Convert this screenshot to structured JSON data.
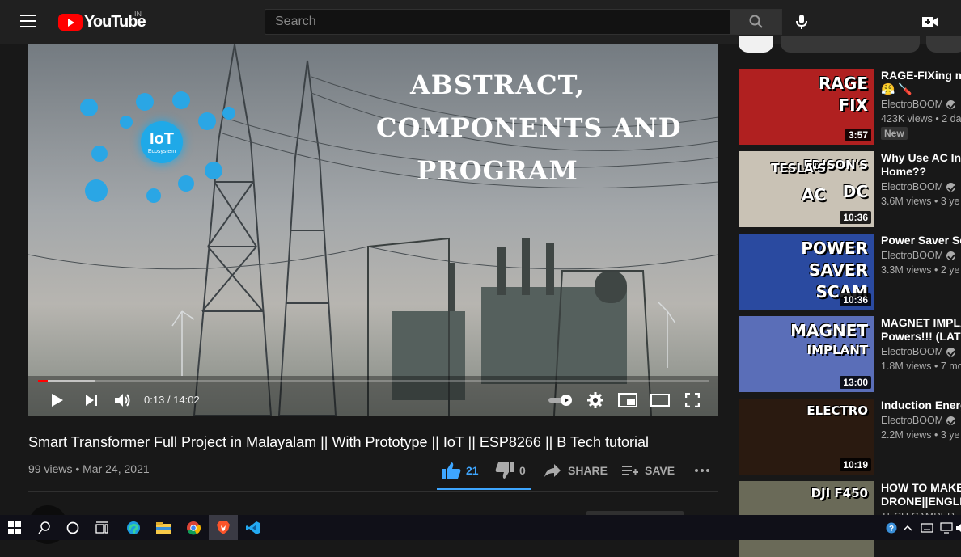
{
  "header": {
    "logo_text": "YouTube",
    "region": "IN",
    "search_placeholder": "Search",
    "icons": [
      "menu-icon",
      "search-icon",
      "mic-icon",
      "create-video-icon"
    ]
  },
  "player": {
    "overlay_lines": [
      "ABSTRACT,",
      "COMPONENTS AND",
      "PROGRAM"
    ],
    "iot_label": "IoT",
    "iot_sub": "Ecosystem",
    "time": "0:13 / 14:02",
    "progress_played": 0.015,
    "progress_loaded": 0.085
  },
  "video": {
    "title": "Smart Transformer Full Project in Malayalam || With Prototype || IoT || ESP8266 || B Tech tutorial",
    "views": "99 views • Mar 24, 2021",
    "likes": "21",
    "dislikes": "0",
    "share_label": "SHARE",
    "save_label": "SAVE"
  },
  "recommendations": [
    {
      "title": "RAGE-FIXing m",
      "title2": "😤 🪛",
      "channel": "ElectroBOOM",
      "meta": "423K views • 2 da",
      "duration": "3:57",
      "badge": "New",
      "thumb_words": [
        "RAGE",
        "FIX"
      ],
      "thumb_color": "#b02020"
    },
    {
      "title": "Why Use AC Ins",
      "title2": "Home??",
      "channel": "ElectroBOOM",
      "meta": "3.6M views • 3 ye",
      "duration": "10:36",
      "thumb_words": [
        "EDISON'S",
        "TESLA'S",
        "DC",
        "AC"
      ],
      "thumb_color": "#c9c2b5"
    },
    {
      "title": "Power Saver Sc",
      "title2": "",
      "channel": "ElectroBOOM",
      "meta": "3.3M views • 2 ye",
      "duration": "10:36",
      "thumb_words": [
        "POWER",
        "SAVER",
        "SCAM"
      ],
      "thumb_color": "#2a4aa0"
    },
    {
      "title": "MAGNET IMPLA",
      "title2": "Powers!!! (LATI",
      "channel": "ElectroBOOM",
      "meta": "1.8M views • 7 mo",
      "duration": "13:00",
      "thumb_words": [
        "MAGNET",
        "IMPLANT"
      ],
      "thumb_color": "#5a6eb8"
    },
    {
      "title": "Induction Energ",
      "title2": "",
      "channel": "ElectroBOOM",
      "meta": "2.2M views • 3 ye",
      "duration": "10:19",
      "thumb_words": [
        "ELECTRO"
      ],
      "thumb_color": "#2a1a10"
    },
    {
      "title": "HOW TO MAKE",
      "title2": "DRONE||ENGLIS",
      "channel": "TECH CAMPER",
      "meta": "",
      "duration": "",
      "thumb_words": [
        "DJI F450"
      ],
      "thumb_color": "#6a6a58"
    }
  ],
  "taskbar": {
    "icons": [
      "windows-start-icon",
      "search-icon",
      "cortana-icon",
      "task-view-icon",
      "edge-icon",
      "file-explorer-icon",
      "chrome-icon",
      "brave-icon",
      "vscode-icon"
    ],
    "tray": [
      "help-icon",
      "chevron-up-icon",
      "keyboard-icon",
      "network-icon",
      "volume-icon"
    ]
  },
  "colors": {
    "brand_red": "#ff0000",
    "accent_blue": "#3ea6ff",
    "background": "#181818"
  }
}
